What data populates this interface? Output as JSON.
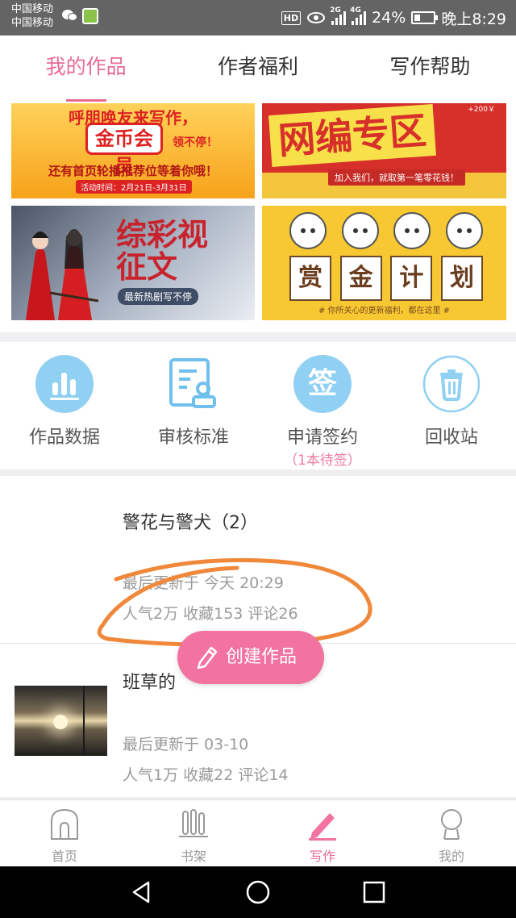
{
  "status_bar": {
    "carrier_1": "中国移动",
    "carrier_2": "中国移动",
    "hd": "HD",
    "sig1_tag": "2G",
    "sig2_tag": "4G",
    "battery_pct": "24%",
    "time": "晚上8:29"
  },
  "top_tabs": [
    {
      "label": "我的作品",
      "active": true
    },
    {
      "label": "作者福利",
      "active": false
    },
    {
      "label": "写作帮助",
      "active": false
    }
  ],
  "banners": {
    "b1": {
      "line1": "呼朋唤友来写作，",
      "badge": "金币会员",
      "line2": "领不停！",
      "line3": "还有首页轮播推荐位等着你哦！",
      "date": "活动时间：2月21日-3月31日"
    },
    "b2": {
      "title": "网编专区",
      "tagline": "加入我们，就取第一笔零花钱！",
      "corner": "+200￥"
    },
    "b3": {
      "title_line1": "综彩视",
      "title_line2": "征文",
      "tagline": "最新热剧写不停"
    },
    "b4": {
      "chars": [
        "赏",
        "金",
        "计",
        "划"
      ],
      "footer": "# 你所关心的更新福利，都在这里 #"
    }
  },
  "actions": [
    {
      "label": "作品数据",
      "icon": "bar-chart-icon"
    },
    {
      "label": "审核标准",
      "icon": "review-document-icon"
    },
    {
      "label": "申请签约",
      "icon": "sign-contract-icon",
      "sub": "（1本待签）",
      "icon_text": "签"
    },
    {
      "label": "回收站",
      "icon": "trash-icon"
    }
  ],
  "works": [
    {
      "title": "警花与警犬（2）",
      "updated": "最后更新于 今天 20:29",
      "stats": "人气2万 收藏153 评论26"
    },
    {
      "title": "班草的",
      "updated": "最后更新于 03-10",
      "stats": "人气1万 收藏22 评论14"
    }
  ],
  "fab": {
    "label": "创建作品"
  },
  "bottom_tabs": [
    {
      "label": "首页",
      "icon": "home-icon",
      "active": false
    },
    {
      "label": "书架",
      "icon": "bookshelf-icon",
      "active": false
    },
    {
      "label": "写作",
      "icon": "write-pencil-icon",
      "active": true
    },
    {
      "label": "我的",
      "icon": "profile-icon",
      "active": false
    }
  ],
  "colors": {
    "accent": "#e86a95",
    "fab": "#f272a0",
    "icon_blue": "#5ab4ea",
    "annotation": "#f0883a"
  }
}
